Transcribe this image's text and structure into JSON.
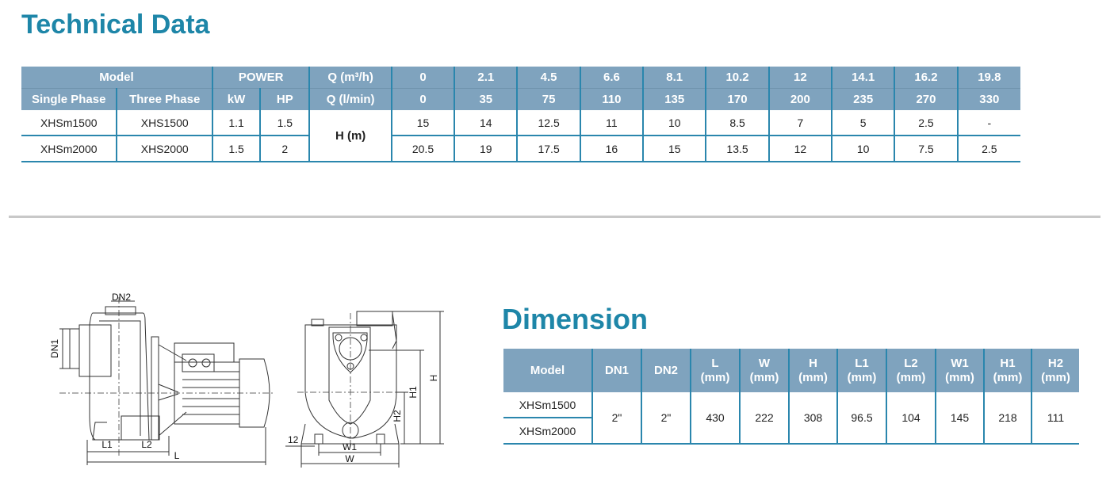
{
  "technical": {
    "title": "Technical Data",
    "header": {
      "model": "Model",
      "power": "POWER",
      "q_m3h": "Q (m³/h)",
      "single_phase": "Single Phase",
      "three_phase": "Three Phase",
      "kw": "kW",
      "hp": "HP",
      "q_lmin": "Q (l/min)",
      "head": "H (m)"
    },
    "flow_m3h": [
      "0",
      "2.1",
      "4.5",
      "6.6",
      "8.1",
      "10.2",
      "12",
      "14.1",
      "16.2",
      "19.8"
    ],
    "flow_lmin": [
      "0",
      "35",
      "75",
      "110",
      "135",
      "170",
      "200",
      "235",
      "270",
      "330"
    ],
    "rows": [
      {
        "single": "XHSm1500",
        "three": "XHS1500",
        "kw": "1.1",
        "hp": "1.5",
        "head": [
          "15",
          "14",
          "12.5",
          "11",
          "10",
          "8.5",
          "7",
          "5",
          "2.5",
          "-"
        ]
      },
      {
        "single": "XHSm2000",
        "three": "XHS2000",
        "kw": "1.5",
        "hp": "2",
        "head": [
          "20.5",
          "19",
          "17.5",
          "16",
          "15",
          "13.5",
          "12",
          "10",
          "7.5",
          "2.5"
        ]
      }
    ]
  },
  "dimension": {
    "title": "Dimension",
    "header": {
      "model": "Model",
      "dn1": "DN1",
      "dn2": "DN2",
      "l": "L",
      "w": "W",
      "h": "H",
      "l1": "L1",
      "l2": "L2",
      "w1": "W1",
      "h1": "H1",
      "h2": "H2",
      "unit": "(mm)"
    },
    "models": [
      "XHSm1500",
      "XHSm2000"
    ],
    "values": {
      "dn1": "2\"",
      "dn2": "2\"",
      "l": "430",
      "w": "222",
      "h": "308",
      "l1": "96.5",
      "l2": "104",
      "w1": "145",
      "h1": "218",
      "h2": "111"
    }
  },
  "drawing_labels": {
    "dn1": "DN1",
    "dn2": "DN2",
    "l": "L",
    "l1": "L1",
    "l2": "L2",
    "h": "H",
    "h1": "H1",
    "h2": "H2",
    "w": "W",
    "w1": "W1",
    "twelve": "12"
  }
}
